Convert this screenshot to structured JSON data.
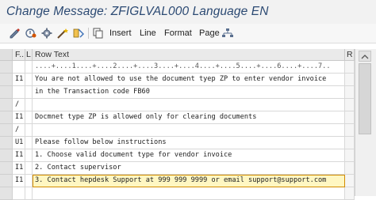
{
  "window": {
    "title": "Change Message: ZFIGLVAL000 Language EN"
  },
  "toolbar": {
    "icons": [
      "edit-pencil-icon",
      "activate-icon",
      "gear-icon",
      "magic-wand-icon",
      "pattern-icon",
      "copy-icon",
      "hierarchy-icon"
    ],
    "insert_label": "Insert",
    "line_label": "Line",
    "format_label": "Format",
    "page_label": "Page"
  },
  "table": {
    "headers": {
      "format": "F..",
      "lang": "L",
      "text": "Row Text",
      "right": "R"
    },
    "ruler": "....+....1....+....2....+....3....+....4....+....5....+....6....+....7..",
    "rows": [
      {
        "format": "I1",
        "text": "You are not allowed to use the document tyep ZP to enter vendor invoice"
      },
      {
        "format": "",
        "text": "in the Transaction code FB60"
      },
      {
        "format": "/",
        "text": ""
      },
      {
        "format": "I1",
        "text": "Docmnet type ZP is allowed only for clearing documents"
      },
      {
        "format": "/",
        "text": ""
      },
      {
        "format": "U1",
        "text": "Please follow below instructions"
      },
      {
        "format": "I1",
        "text": "1. Choose valid document type for vendor invoice"
      },
      {
        "format": "I1",
        "text": "2. Contact supervisor"
      },
      {
        "format": "I1",
        "text": "3. Contact hepdesk Support at 999 999 9999 or email support@support.com"
      }
    ],
    "selected_row_index": 8
  }
}
